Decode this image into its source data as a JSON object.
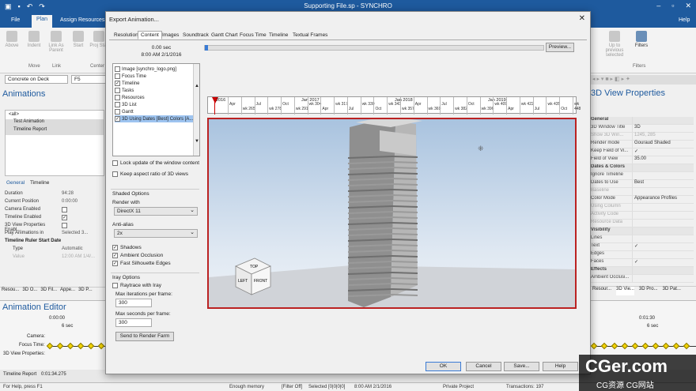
{
  "titlebar": {
    "title": "Supporting File.sp - SYNCHRO",
    "help_label": "Help"
  },
  "ribbon": {
    "tabs": [
      "File",
      "Plan",
      "Assign Resources"
    ],
    "buttons": [
      "Above",
      "Indent",
      "Link As Parent",
      "Start",
      "Proj Star"
    ],
    "groups": [
      "Move",
      "Link",
      "Center"
    ],
    "right_buttons": [
      "Up to previous selected",
      "Filters"
    ],
    "right_group": "Filters"
  },
  "left": {
    "resource_value": "Concrete on Deck",
    "field2_value": "F5",
    "animations_title": "Animations",
    "tree_items": [
      "<all>",
      "Test Animation",
      "Timeline Report"
    ],
    "tabs": [
      "General",
      "Timeline"
    ],
    "props": [
      {
        "k": "Duration",
        "v": "94:28"
      },
      {
        "k": "Current Position",
        "v": "0:00:00"
      },
      {
        "k": "Camera Enabled",
        "v": ""
      },
      {
        "k": "Timeline Enabled",
        "v": "✓"
      },
      {
        "k": "3D View Properties Enabl...",
        "v": ""
      },
      {
        "k": "Play Animations in",
        "v": "Selected 3..."
      }
    ],
    "ruler_section": "Timeline Ruler Start Date",
    "ruler_props": [
      {
        "k": "Type",
        "v": "Automatic"
      },
      {
        "k": "Value",
        "v": "12:00 AM 1/4/..."
      }
    ],
    "bottom_tabs": [
      "Resou...",
      "3D O...",
      "3D Fil...",
      "Appe...",
      "3D P..."
    ]
  },
  "anim_editor": {
    "title": "Animation Editor",
    "time_start": "0:00:00",
    "interval_left": "6 sec",
    "time_right": "0:01:30",
    "interval_right": "6 sec",
    "rows": [
      "Camera:",
      "Focus Time:",
      "3D View Properties:"
    ],
    "footer": "Timeline Report",
    "footer_time": "0:01:34.275"
  },
  "right": {
    "title": "3D View Properties",
    "bottom_tabs": [
      "Resour...",
      "3D Vie...",
      "3D Pro...",
      "3D Pat..."
    ],
    "rows": [
      {
        "k": "General",
        "v": "",
        "type": "hdr"
      },
      {
        "k": "3D Window Title",
        "v": "3D"
      },
      {
        "k": "Show 3D Win...",
        "v": "1245, 285",
        "type": "dim"
      },
      {
        "k": "Render mode",
        "v": "Gouraud Shaded"
      },
      {
        "k": "Keep Field of Vi...",
        "v": "✓"
      },
      {
        "k": "Field of View",
        "v": "35.00"
      },
      {
        "k": "Dates & Colors",
        "v": "",
        "type": "hdr"
      },
      {
        "k": "Ignore Timeline",
        "v": ""
      },
      {
        "k": "Dates to Use",
        "v": "Best"
      },
      {
        "k": "Baseline",
        "v": "",
        "type": "dim"
      },
      {
        "k": "Color Mode",
        "v": "Appearance Profiles"
      },
      {
        "k": "Using Column",
        "v": "",
        "type": "dim"
      },
      {
        "k": "Activity Code",
        "v": "",
        "type": "dim"
      },
      {
        "k": "Resource Data",
        "v": "",
        "type": "dim"
      },
      {
        "k": "Visibility",
        "v": "",
        "type": "hdr"
      },
      {
        "k": "Lines",
        "v": ""
      },
      {
        "k": "Text",
        "v": "✓"
      },
      {
        "k": "Edges",
        "v": ""
      },
      {
        "k": "Faces",
        "v": "✓"
      },
      {
        "k": "Effects",
        "v": "",
        "type": "hdr"
      },
      {
        "k": "Ambient Occlusi...",
        "v": ""
      }
    ]
  },
  "dialog": {
    "title": "Export Animation...",
    "tabs": [
      "Resolution",
      "Content",
      "Images",
      "Soundtrack",
      "Gantt Chart",
      "Focus Time",
      "Timeline",
      "Textual Frames"
    ],
    "time_label": "0.00 sec",
    "date_label": "8:00 AM 2/1/2016",
    "preview_label": "Preview...",
    "layers": [
      {
        "label": "Image [synchro_logo.png]",
        "checked": ""
      },
      {
        "label": "Focus Time",
        "checked": ""
      },
      {
        "label": "Timeline",
        "checked": "✓"
      },
      {
        "label": "Tasks",
        "checked": ""
      },
      {
        "label": "Resources",
        "checked": ""
      },
      {
        "label": "3D List",
        "checked": ""
      },
      {
        "label": "Gantt",
        "checked": ""
      },
      {
        "label": "3D Using Dates [Best] Colors [A...",
        "checked": "✓"
      }
    ],
    "lock_label": "Lock update of the window content",
    "aspect_label": "Keep aspect ratio of 3D views",
    "shaded_title": "Shaded Options",
    "render_with_label": "Render with",
    "render_with_value": "DirectX 11",
    "antialias_label": "Anti-alias",
    "antialias_value": "2x",
    "shadows_label": "Shadows",
    "ao_label": "Ambient Occlusion",
    "fast_label": "Fast Silhouette Edges",
    "iray_title": "Iray Options",
    "raytrace_label": "Raytrace with Iray",
    "max_iter_label": "Max iterations per frame:",
    "max_iter_value": "300",
    "max_sec_label": "Max seconds per frame:",
    "max_sec_value": "300",
    "render_farm_label": "Send to Render Farm",
    "ruler_years": [
      "2016",
      "Jan 2017",
      "Jan 2018",
      "Jan 2019"
    ],
    "ruler_weeks": [
      "Apr",
      "wk 265",
      "Jul",
      "wk 278",
      "Oct",
      "wk 291",
      "wk 304",
      "Apr",
      "wk 317",
      "Jul",
      "wk 330",
      "Oct",
      "wk 343",
      "wk 357",
      "Apr",
      "wk 369",
      "Jul",
      "wk 382",
      "Oct",
      "wk 396",
      "wk 409",
      "Apr",
      "wk 422",
      "Jul",
      "wk 435",
      "Oct",
      "wk 448"
    ],
    "cube_top": "TOP",
    "cube_left": "LEFT",
    "cube_front": "FRONT",
    "ok_label": "OK",
    "cancel_label": "Cancel",
    "save_label": "Save...",
    "help_label": "Help"
  },
  "status": {
    "help_text": "For Help, press F1",
    "memory": "Enough memory",
    "filter": "[Filter Off]",
    "selected": "Selected [0|0|0|0]",
    "date": "8:00 AM 2/1/2016",
    "project": "Private Project",
    "transactions": "Transactions: 197"
  },
  "watermark": {
    "main": "CGer.com",
    "sub": "CG资源 CG网站"
  }
}
